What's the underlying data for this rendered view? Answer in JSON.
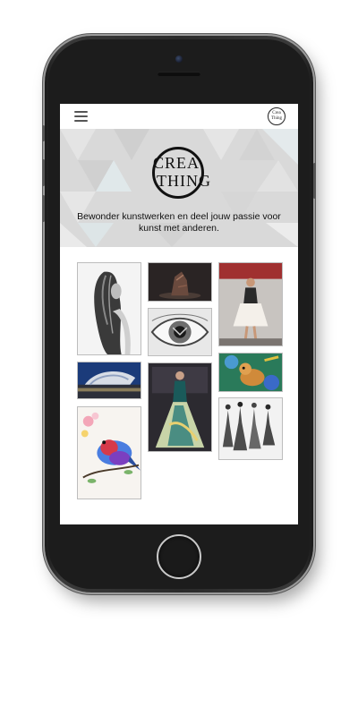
{
  "app": {
    "logo_line1": "CREA",
    "logo_line2": "THING",
    "mini_logo_line1": "Crea",
    "mini_logo_line2": "Thing",
    "tagline": "Bewonder kunstwerken en deel jouw passie voor kunst met anderen."
  },
  "icons": {
    "menu": "hamburger-icon"
  },
  "colors": {
    "hero_background": "#dcdcdc",
    "accent_text": "#111111"
  }
}
